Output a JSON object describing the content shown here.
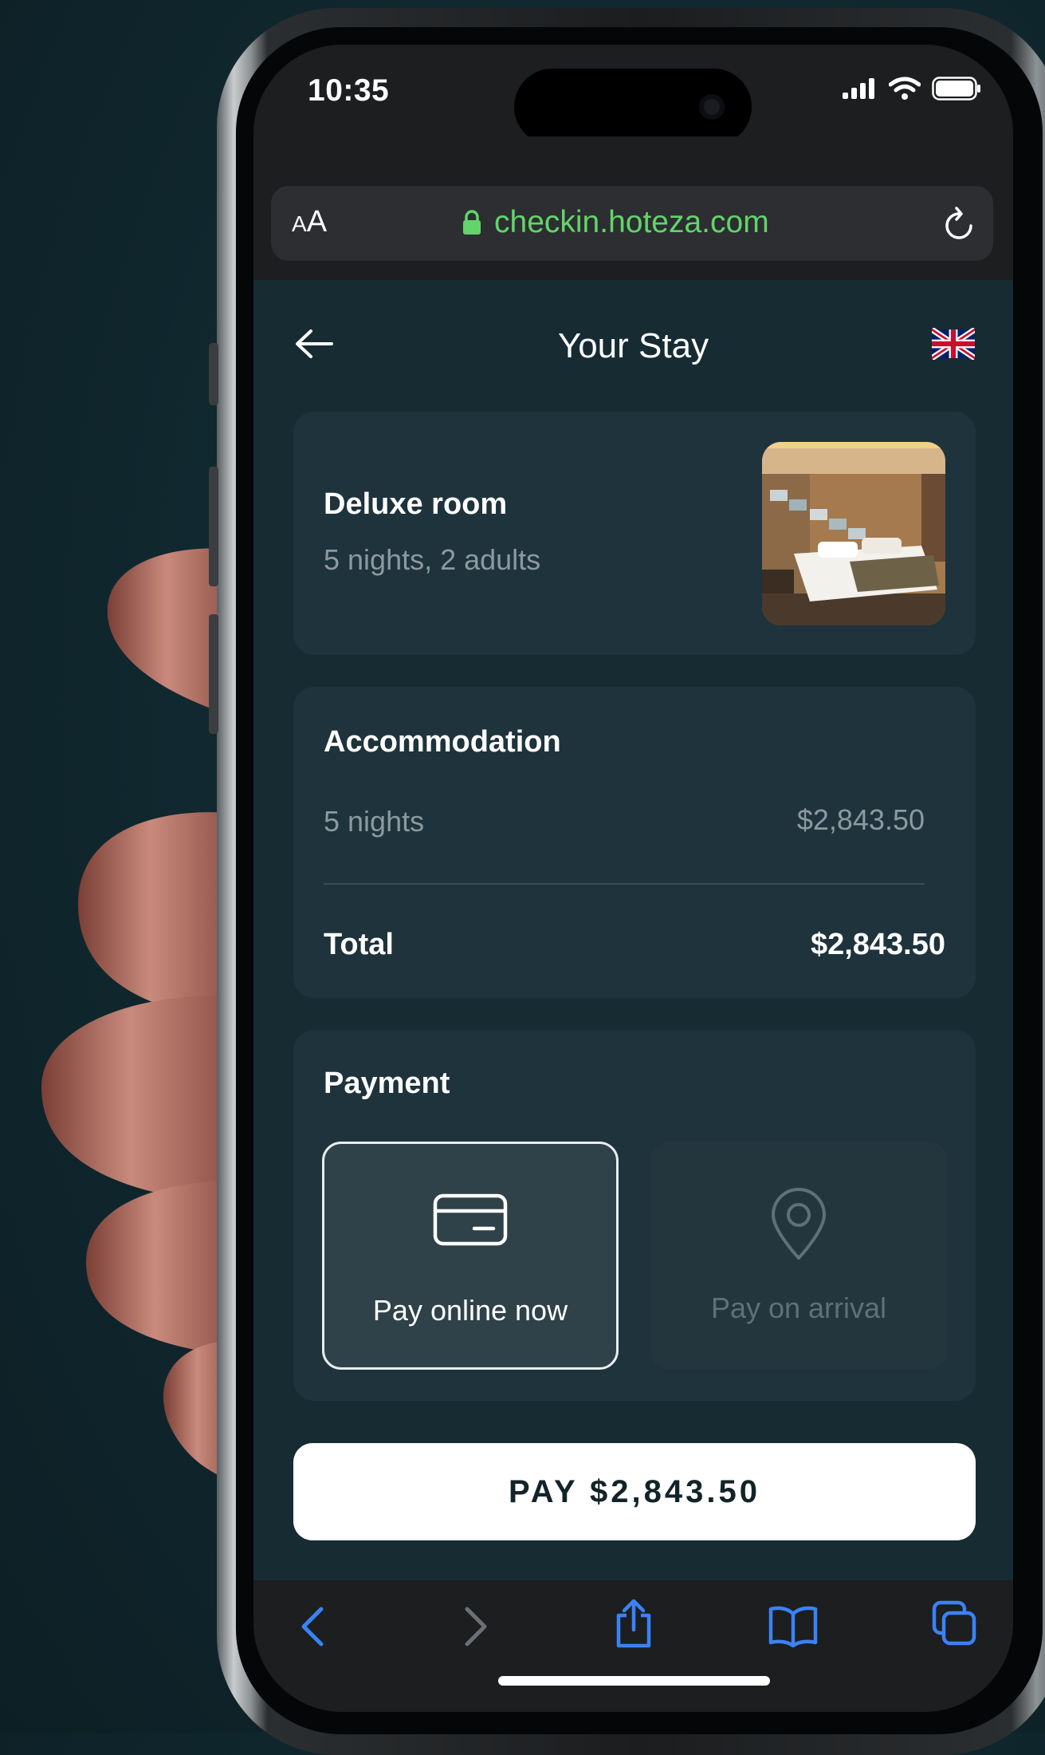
{
  "status_bar": {
    "time": "10:35"
  },
  "browser": {
    "text_size_small": "A",
    "text_size_large": "A",
    "url": "checkin.hoteza.com"
  },
  "page": {
    "title": "Your Stay",
    "language_flag": "uk-flag"
  },
  "room": {
    "name": "Deluxe room",
    "details": "5 nights, 2 adults"
  },
  "accommodation": {
    "heading": "Accommodation",
    "line_label": "5 nights",
    "line_value": "$2,843.50",
    "total_label": "Total",
    "total_value": "$2,843.50"
  },
  "payment": {
    "heading": "Payment",
    "options": [
      {
        "label": "Pay online now",
        "icon": "credit-card-icon",
        "selected": true
      },
      {
        "label": "Pay on arrival",
        "icon": "location-pin-icon",
        "selected": false
      }
    ]
  },
  "pay_button": {
    "label": "PAY $2,843.50"
  },
  "colors": {
    "page_bg": "#172b33",
    "card_bg": "#1e333c",
    "url_green": "#62d46a",
    "toolbar_blue": "#3b82f6"
  }
}
